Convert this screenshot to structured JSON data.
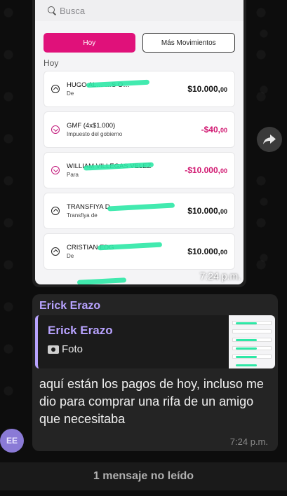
{
  "screenshot": {
    "search_placeholder": "Busca",
    "tabs": [
      {
        "label": "Hoy",
        "active": true
      },
      {
        "label": "Más Movimientos",
        "active": false
      }
    ],
    "section_label": "Hoy",
    "transactions": [
      {
        "name": "HUGO AL…   …S O…",
        "sub": "De",
        "amount": "$10.000,",
        "cents": "00",
        "direction": "in"
      },
      {
        "name": "GMF (4x$1.000)",
        "sub": "Impuesto del gobierno",
        "amount": "-$40,",
        "cents": "00",
        "direction": "out"
      },
      {
        "name": "WILLIAM   VILLEGAS VELEZ",
        "sub": "Para",
        "amount": "-$10.000,",
        "cents": "00",
        "direction": "out"
      },
      {
        "name": "TRANSFIYA D",
        "sub": "Transfiya de",
        "amount": "$10.000,",
        "cents": "00",
        "direction": "in"
      },
      {
        "name": "CRISTIAN EDG",
        "sub": "De",
        "amount": "$10.000,",
        "cents": "00",
        "direction": "in"
      }
    ],
    "colors": {
      "accent": "#e0117a",
      "negative": "#d0156f",
      "highlight": "#2ee8a6"
    }
  },
  "image_message": {
    "time": "7:24 p.m."
  },
  "message": {
    "sender": "Erick Erazo",
    "quote": {
      "sender": "Erick Erazo",
      "type_label": "Foto",
      "icon": "camera-icon"
    },
    "text": "aquí están los pagos de hoy, incluso me dio para comprar una rifa de un amigo que necesitaba",
    "time": "7:24 p.m."
  },
  "avatar": {
    "initials": "EE",
    "color": "#8a7ad6"
  },
  "unread_banner": "1 mensaje no leído",
  "colors": {
    "sender_name": "#b8a3ff",
    "bubble": "#242424"
  }
}
